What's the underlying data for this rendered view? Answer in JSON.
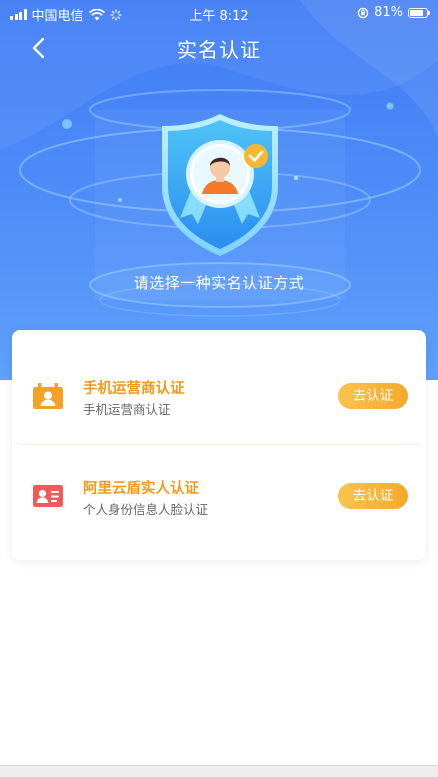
{
  "status_bar": {
    "carrier": "中国电信",
    "time": "上午 8:12",
    "battery": "81%",
    "battery_level": 0.81
  },
  "nav": {
    "title": "实名认证",
    "back_icon": "chevron-left-icon"
  },
  "hero": {
    "subtitle": "请选择一种实名认证方式",
    "badge_icon": "verified-shield-icon"
  },
  "methods": [
    {
      "title": "手机运营商认证",
      "desc": "手机运营商认证",
      "button": "去认证",
      "icon": "phone-carrier-icon"
    },
    {
      "title": "阿里云盾实人认证",
      "desc": "个人身份信息人脸认证",
      "button": "去认证",
      "icon": "id-card-icon"
    }
  ],
  "colors": {
    "brand_blue": "#3f7cf5",
    "accent_orange": "#f39a1a",
    "button_gradient_start": "#f8c44e",
    "button_gradient_end": "#f6a82c"
  }
}
